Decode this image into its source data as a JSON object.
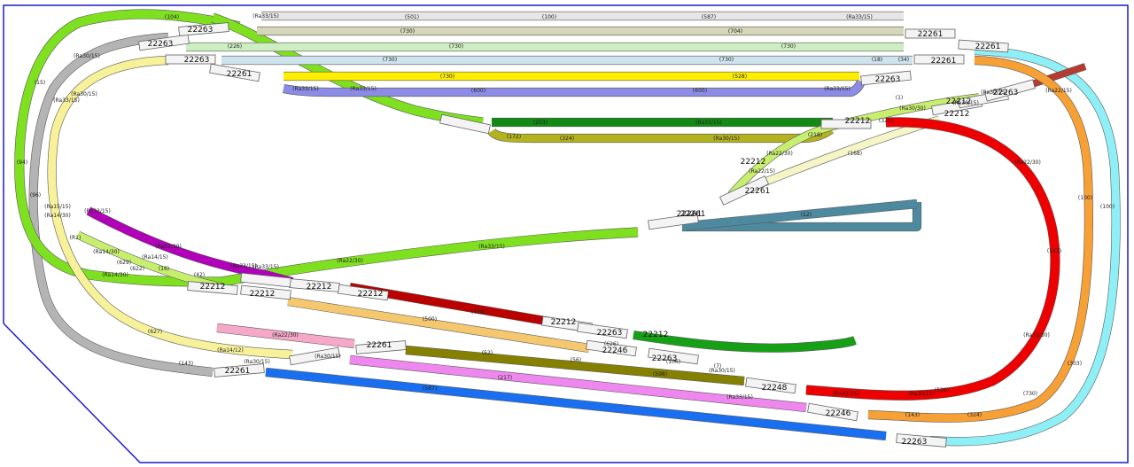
{
  "colors": {
    "border": "#1c1cc8",
    "lime": "#7fe020",
    "lightlime": "#c8ee70",
    "grey": "#b4b4b4",
    "paleyellow": "#f7f29a",
    "lightgrey": "#e6e6e6",
    "khaki": "#d6d6b8",
    "palegreen": "#cdeec0",
    "paleblue": "#cfe3ee",
    "yellow": "#ffee00",
    "periwinkle": "#8c8ce6",
    "darkgreen": "#138a13",
    "olive": "#b3b320",
    "cream": "#f5f5c8",
    "steel": "#4d8aa0",
    "purple": "#b000b8",
    "red": "#ee0000",
    "darkred": "#bb0000",
    "green": "#16a016",
    "sand": "#f5c870",
    "pink": "#f6a8c8",
    "darkolive": "#858000",
    "violet": "#ee88ee",
    "blue": "#1a6ff0",
    "orange": "#f7a035",
    "cyan": "#8ef0f6",
    "brown": "#b43c32"
  },
  "switch_labels": [
    "22263",
    "22263",
    "22263",
    "22261",
    "22261",
    "22261",
    "22263",
    "22261",
    "22212",
    "22212",
    "22263",
    "22212",
    "22212",
    "22261",
    "22261",
    "22212",
    "22212",
    "22212",
    "22261",
    "22212",
    "22212",
    "22212",
    "22263",
    "22263",
    "22246",
    "22261",
    "22261",
    "22248",
    "22246",
    "22263"
  ],
  "track_labels": [
    "(104)",
    "(Ra33/15)",
    "(501)",
    "(100)",
    "(587)",
    "(Ra33/15)",
    "(730)",
    "(704)",
    "(226)",
    "(730)",
    "(730)",
    "(730)",
    "(730)",
    "(18)",
    "(34)",
    "(730)",
    "(528)",
    "(Ra33/15)",
    "(Ra33/15)",
    "(600)",
    "(600)",
    "(Ra33/15)",
    "(Ra30/15)",
    "(15)",
    "(Ra33/15)",
    "(Ra30/15)",
    "(203)",
    "(Ra33/15)",
    "(172)",
    "(324)",
    "(Ra30/15)",
    "(218)",
    "(325)",
    "(Ra36/15)",
    "(Ra22/30)",
    "(Ra22/15)",
    "(Ra30/30)",
    "(Ra30/15)",
    "(Ra22/15)",
    "(168)",
    "(Ra22/30)",
    "(100)",
    "(100)",
    "(1)",
    "(Ra15/15)",
    "(96)",
    "(94)",
    "(Ra14/30)",
    "(R1)",
    "(Ra14/30)",
    "(629)",
    "(Ra14/15)",
    "(16)",
    "(Ra22/30)",
    "(42)",
    "(Ra14/30)",
    "(Ra33/15)",
    "(Ra33/15)",
    "(Ra22/30)",
    "(Ra33/15)",
    "(12)",
    "(Ra33/15)",
    "(622)",
    "(627)",
    "(Ra22/30)",
    "(Ra14/12)",
    "(626)",
    "(458)",
    "(500)",
    "(143)",
    "(Ra30/15)",
    "(Ra30/15)",
    "(52)",
    "(56)",
    "(598)",
    "(106)",
    "(7)",
    "(Ra30/15)",
    "(217)",
    "(Ra33/15)",
    "(587)",
    "(324)",
    "(143)",
    "(730)",
    "(303)",
    "(Ra33/15)",
    "(526)",
    "(Ra22/30)",
    "(143)",
    "(Ra30/15)",
    "(103)",
    "(Ra30/15)"
  ]
}
